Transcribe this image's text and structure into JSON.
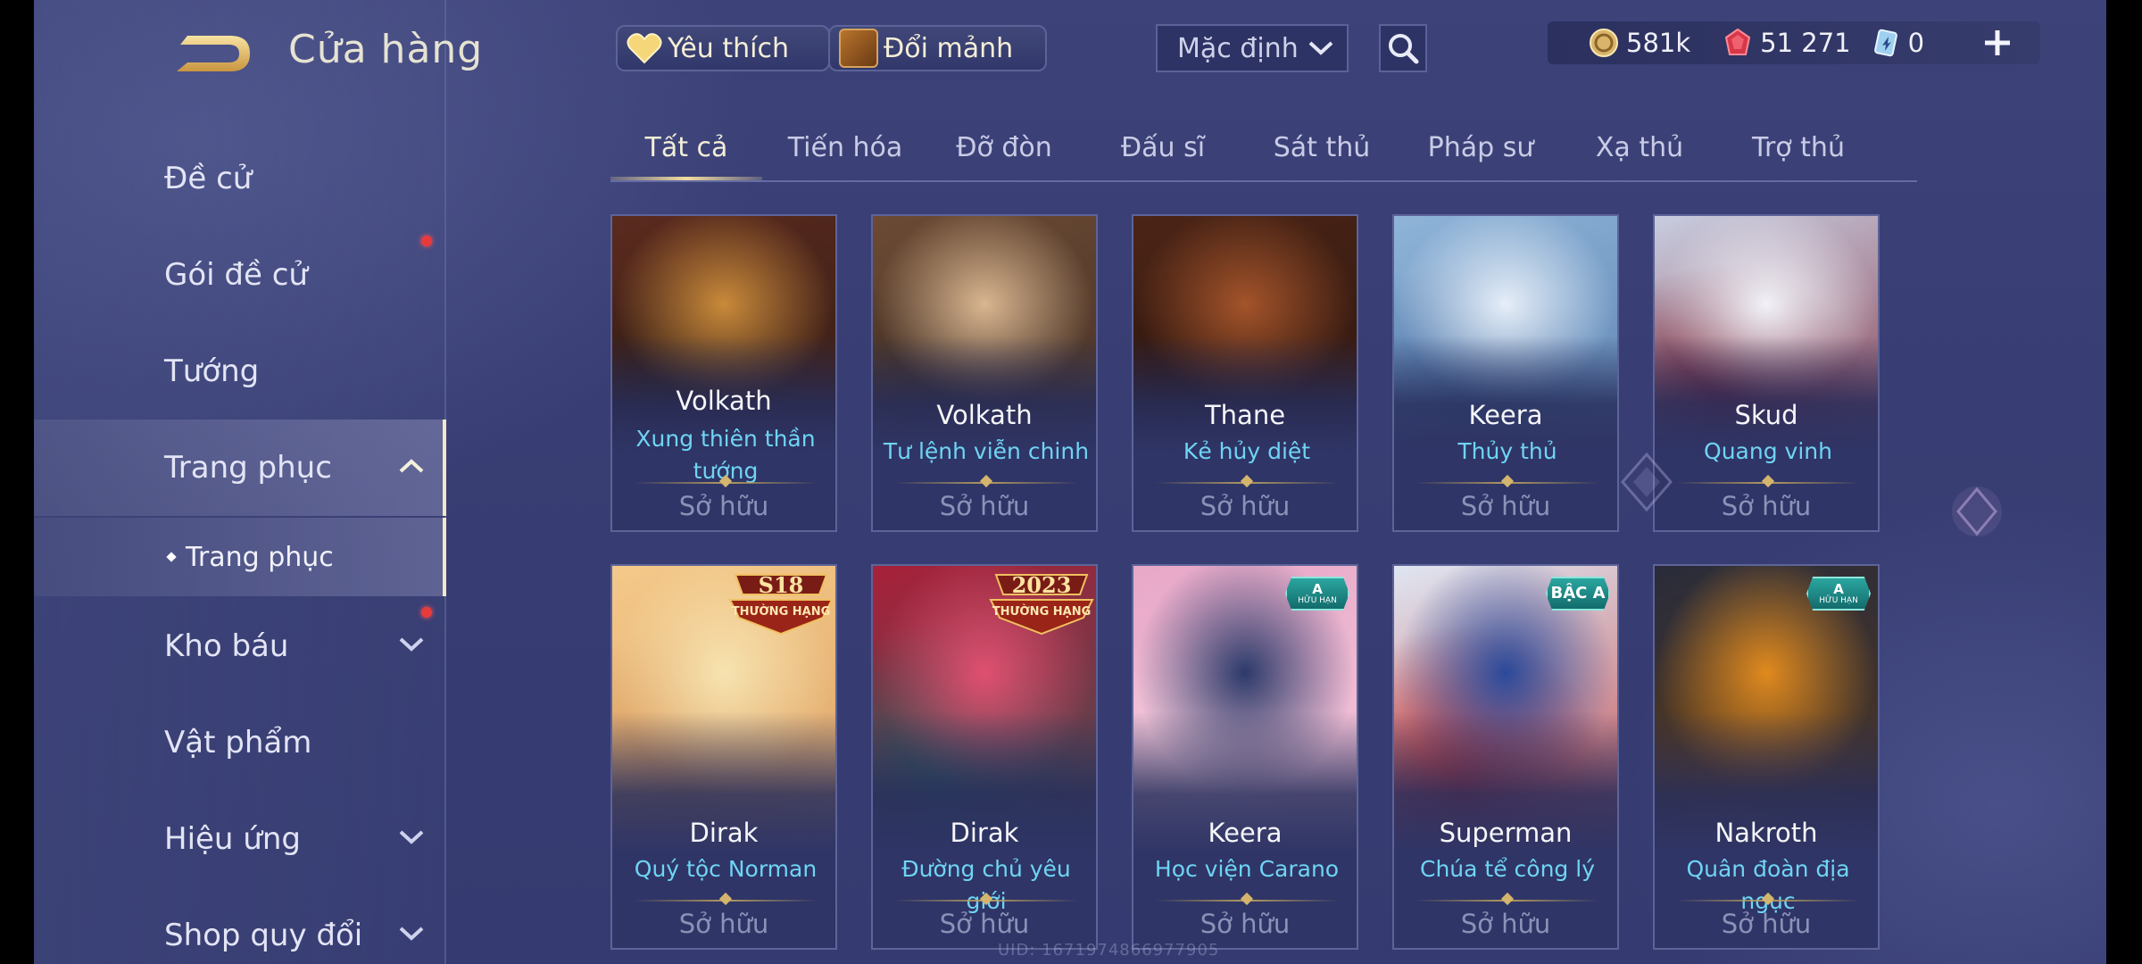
{
  "header": {
    "title": "Cửa hàng",
    "favorites_label": "Yêu thích",
    "shard_exchange_label": "Đổi mảnh",
    "sort_select": {
      "selected": "Mặc định"
    }
  },
  "currencies": [
    {
      "name": "gold",
      "icon": "gold-coin-icon",
      "value": "581k"
    },
    {
      "name": "ruby",
      "icon": "ruby-gem-icon",
      "value": "51 271"
    },
    {
      "name": "voucher",
      "icon": "voucher-icon",
      "value": "0"
    }
  ],
  "sidebar": {
    "items": [
      {
        "label": "Đề cử"
      },
      {
        "label": "Gói đề cử",
        "notification": true
      },
      {
        "label": "Tướng"
      },
      {
        "label": "Trang phục",
        "expanded": true,
        "active": true
      },
      {
        "label": "Kho báu",
        "notification": true,
        "expandable": true
      },
      {
        "label": "Vật phẩm"
      },
      {
        "label": "Hiệu ứng",
        "expandable": true
      },
      {
        "label": "Shop quy đổi",
        "expandable": true
      }
    ],
    "subitem": {
      "label": "Trang phục"
    }
  },
  "tabs": [
    "Tất cả",
    "Tiến hóa",
    "Đỡ đòn",
    "Đấu sĩ",
    "Sát thủ",
    "Pháp sư",
    "Xạ thủ",
    "Trợ thủ"
  ],
  "active_tab": "Tất cả",
  "cards": [
    {
      "hero": "Volkath",
      "skin": "Xung thiên thần tướng",
      "status": "Sở hữu",
      "colors": [
        "#5a2a1e",
        "#c98a3a",
        "#2b1a14"
      ]
    },
    {
      "hero": "Volkath",
      "skin": "Tư lệnh viễn chinh",
      "status": "Sở hữu",
      "colors": [
        "#6b4a34",
        "#d9b690",
        "#3c2b22"
      ]
    },
    {
      "hero": "Thane",
      "skin": "Kẻ hủy diệt",
      "status": "Sở hữu",
      "colors": [
        "#4a2416",
        "#a4542a",
        "#2a140e"
      ]
    },
    {
      "hero": "Keera",
      "skin": "Thủy thủ",
      "status": "Sở hữu",
      "colors": [
        "#8fb4d8",
        "#e6eef8",
        "#4f76a8"
      ]
    },
    {
      "hero": "Skud",
      "skin": "Quang vinh",
      "status": "Sở hữu",
      "colors": [
        "#c8cde0",
        "#f2f2f8",
        "#7a2030"
      ]
    },
    {
      "hero": "Dirak",
      "skin": "Quý tộc Norman",
      "status": "Sở hữu",
      "colors": [
        "#f4c98a",
        "#f7e3b0",
        "#d79a5e"
      ],
      "badge": {
        "type": "rank",
        "top": "S18",
        "bottom": "THƯỜNG HẠNG"
      }
    },
    {
      "hero": "Dirak",
      "skin": "Đường chủ yêu giới",
      "status": "Sở hữu",
      "colors": [
        "#a8213a",
        "#e05070",
        "#2b5a5a"
      ],
      "badge": {
        "type": "rank",
        "top": "2023",
        "bottom": "THƯỜNG HẠNG"
      }
    },
    {
      "hero": "Keera",
      "skin": "Học viện Carano",
      "status": "Sở hữu",
      "colors": [
        "#e8a8c8",
        "#2c3a6a",
        "#f7d2e0"
      ],
      "badge": {
        "type": "tier",
        "line1": "A",
        "line2": "HỮU HẠN"
      }
    },
    {
      "hero": "Superman",
      "skin": "Chúa tể công lý",
      "status": "Sở hữu",
      "colors": [
        "#dfe6f2",
        "#2b4a9a",
        "#c02c2c"
      ],
      "badge": {
        "type": "tier",
        "line1": "BẬC A",
        "line2": ""
      }
    },
    {
      "hero": "Nakroth",
      "skin": "Quân đoàn địa ngục",
      "status": "Sở hữu",
      "colors": [
        "#2a2c3a",
        "#e08a1e",
        "#5a3a1a"
      ],
      "badge": {
        "type": "tier",
        "line1": "A",
        "line2": "HỮU HẠN"
      }
    }
  ],
  "footer": {
    "uid": "UID: 1671974866977905"
  }
}
